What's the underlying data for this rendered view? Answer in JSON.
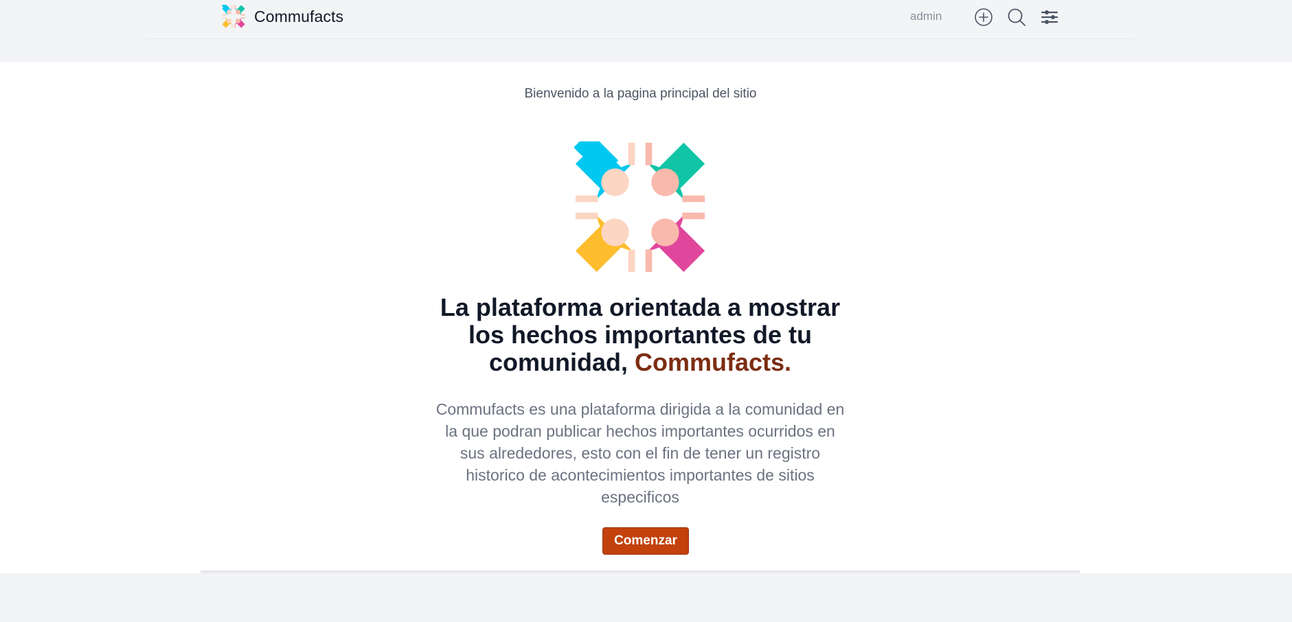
{
  "header": {
    "app_name": "Commufacts",
    "user_name": "admin",
    "icons": {
      "logo": "commufacts-logo-icon",
      "add": "plus-circle-icon",
      "search": "search-icon",
      "settings": "sliders-icon"
    }
  },
  "hero": {
    "welcome_text": "Bienvenido a la pagina principal del sitio",
    "headline": "La plataforma orientada a mostrar los hechos importantes de tu comunidad,",
    "headline_accent": "Commufacts.",
    "description": "Commufacts es una plataforma dirigida a la comunidad en la que podran publicar hechos importantes ocurridos en sus alrededores, esto con el fin de tener un registro historico de acontecimientos importantes de sitios especificos",
    "cta_label": "Comenzar"
  },
  "colors": {
    "page_background": "#f3f4f6",
    "hero_background": "#ffffff",
    "accent_text": "#7c2d12",
    "cta_background": "#c2410c",
    "logo_cyan": "#00c8f0",
    "logo_teal": "#10c4a6",
    "logo_yellow": "#fdbd2c",
    "logo_pink": "#e0479c"
  }
}
